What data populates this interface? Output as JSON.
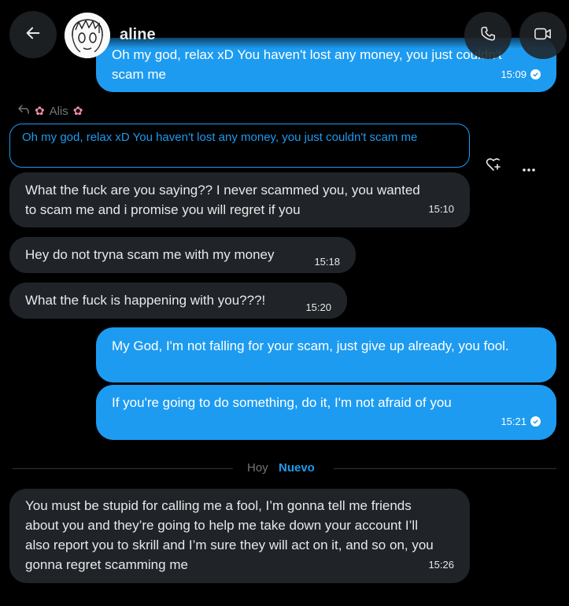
{
  "header": {
    "contact_name": "aline",
    "back_icon": "arrow-left-icon",
    "call_icon": "phone-icon",
    "video_icon": "video-camera-icon"
  },
  "messages": {
    "top_out": {
      "text": "Oh my god, relax xD You haven't lost any money, you just couldn't scam me",
      "time": "15:09"
    },
    "reply_to": {
      "sender": "Alis",
      "quote": "Oh my god, relax xD You haven't lost any money, you just couldn't scam me"
    },
    "in1": {
      "text": "What the fuck are you saying?? I never scammed you, you wanted to scam me and i promise you will regret if you",
      "time": "15:10"
    },
    "in2": {
      "text": "Hey do not tryna scam me with my money",
      "time": "15:18"
    },
    "in3": {
      "text": "What the fuck is happening with you???!",
      "time": "15:20"
    },
    "out1": {
      "text": "My God, I'm not falling for your scam, just give up already, you fool."
    },
    "out2": {
      "text": "If you're going to do something, do it, I'm not afraid of you",
      "time": "15:21"
    },
    "in4": {
      "text": "You must be stupid for calling me a fool, I’m gonna tell me friends about you and they’re going to help me take down your account I’ll also report you to skrill and I’m sure they will act on it, and so on, you gonna regret scamming me",
      "time": "15:26"
    }
  },
  "divider": {
    "day": "Hoy",
    "new": "Nuevo"
  },
  "colors": {
    "accent": "#1d9bf0",
    "incoming": "#202327",
    "background": "#000000"
  }
}
